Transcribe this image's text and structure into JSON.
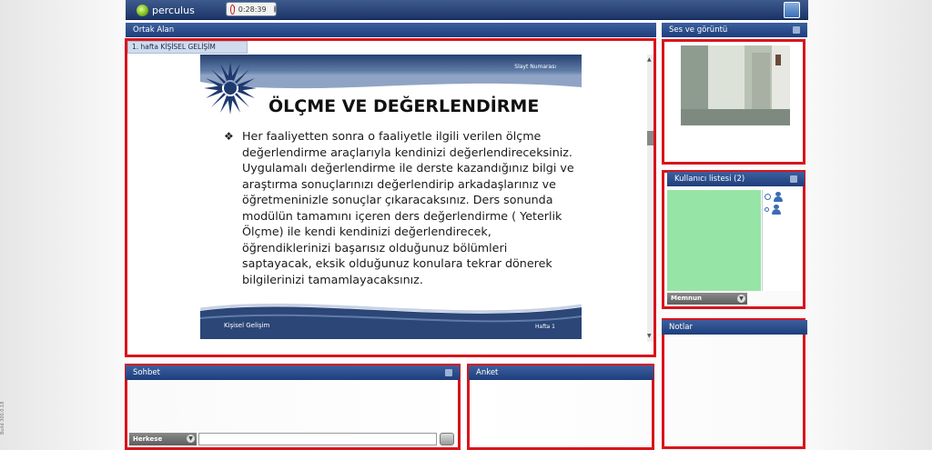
{
  "app": {
    "logo_text": "perculus",
    "timer": "0:28:39"
  },
  "shared": {
    "title": "Ortak Alan",
    "doc_tab": "1. hafta KİŞİSEL GELİŞİM"
  },
  "slide": {
    "header_label": "Slayt Numarası",
    "title": "ÖLÇME VE DEĞERLENDİRME",
    "bullet": "❖",
    "body": "Her faaliyetten sonra o faaliyetle ilgili verilen ölçme değerlendirme araçlarıyla kendinizi değerlendireceksiniz. Uygulamalı değerlendirme ile derste kazandığınız bilgi ve araştırma sonuçlarınızı değerlendirip arkadaşlarınız ve öğretmeninizle sonuçlar çıkaracaksınız. Ders sonunda modülün tamamını içeren ders değerlendirme ( Yeterlik Ölçme) ile kendi kendinizi değerlendirecek, öğrendiklerinizi başarısız olduğunuz bölümleri saptayacak, eksik olduğunuz konulara tekrar dönerek bilgilerinizi tamamlayacaksınız.",
    "footer_left": "Kişisel Gelişim",
    "footer_right": "Hafta 1"
  },
  "video": {
    "title": "Ses ve görüntü"
  },
  "users": {
    "title": "Kullanıcı listesi (2)",
    "mood": "Memnun"
  },
  "notes": {
    "title": "Notlar"
  },
  "chat": {
    "title": "Sohbet",
    "target": "Herkese",
    "input_value": ""
  },
  "poll": {
    "title": "Anket"
  },
  "build": "Build 300.0.18",
  "colors": {
    "header_blue": "#1e3e7c",
    "highlight_red": "#d9141b",
    "user_area_green": "#96e5a6"
  }
}
